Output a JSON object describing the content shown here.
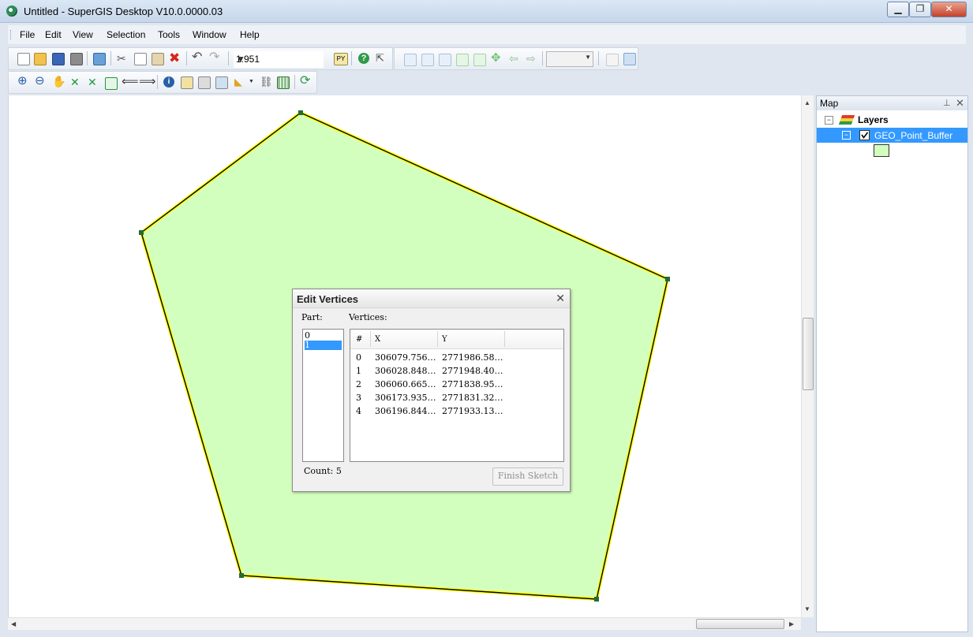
{
  "window": {
    "title": "Untitled - SuperGIS Desktop V10.0.0000.03",
    "controls": [
      "minimize-icon",
      "maximize-icon",
      "close-icon"
    ]
  },
  "menu": [
    "File",
    "Edit",
    "View",
    "Selection",
    "Tools",
    "Window",
    "Help"
  ],
  "toolbar": {
    "scale_value": "1:951",
    "python_label": "PY",
    "extra_combo_value": ""
  },
  "map_panel": {
    "title": "Map",
    "layers_label": "Layers",
    "layer_name": "GEO_Point_Buffer",
    "layer_checked": true,
    "symbol_color": "#d3ffbe"
  },
  "map_canvas": {
    "polygon_fill": "#d3ffbe",
    "polygon_outline": "#ffff00",
    "edge_color": "#000000",
    "vertex_color": "#1f6b3a"
  },
  "dialog": {
    "title": "Edit Vertices",
    "part_label": "Part:",
    "vertices_label": "Vertices:",
    "parts": [
      "0",
      "1"
    ],
    "selected_part": "1",
    "columns": [
      "#",
      "X",
      "Y"
    ],
    "vertices": [
      {
        "index": "0",
        "x": "306079.756…",
        "y": "2771986.58…"
      },
      {
        "index": "1",
        "x": "306028.848…",
        "y": "2771948.40…"
      },
      {
        "index": "2",
        "x": "306060.665…",
        "y": "2771838.95…"
      },
      {
        "index": "3",
        "x": "306173.935…",
        "y": "2771831.32…"
      },
      {
        "index": "4",
        "x": "306196.844…",
        "y": "2771933.13…"
      }
    ],
    "count_label": "Count: 5",
    "finish_button": "Finish Sketch"
  }
}
